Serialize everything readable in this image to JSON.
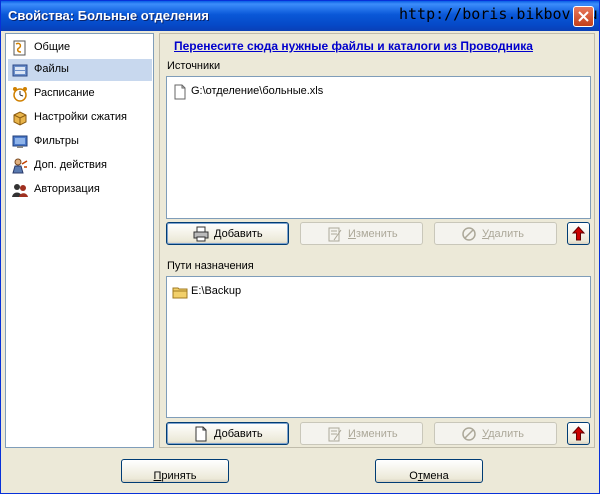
{
  "window": {
    "title": "Свойства: Больные отделения",
    "watermark": "http://boris.bikbov.ru"
  },
  "colors": {
    "title_bar": "#0a58d8",
    "link": "#0000cc",
    "selected_nav": "#c8d8ee",
    "up_arrow": "#cc0000"
  },
  "sidebar": {
    "items": [
      {
        "label": "Общие",
        "icon": "general-icon",
        "selected": false
      },
      {
        "label": "Файлы",
        "icon": "files-icon",
        "selected": true
      },
      {
        "label": "Расписание",
        "icon": "alarm-clock-icon",
        "selected": false
      },
      {
        "label": "Настройки сжатия",
        "icon": "compression-box-icon",
        "selected": false
      },
      {
        "label": "Фильтры",
        "icon": "monitor-icon",
        "selected": false
      },
      {
        "label": "Доп. действия",
        "icon": "person-action-icon",
        "selected": false
      },
      {
        "label": "Авторизация",
        "icon": "users-auth-icon",
        "selected": false
      }
    ]
  },
  "main": {
    "hint": "Перенесите сюда нужные файлы и каталоги из Проводника",
    "sources": {
      "label": "Источники",
      "items": [
        {
          "text": "G:\\отделение\\больные.xls",
          "icon": "file-icon"
        }
      ],
      "add": {
        "first": "Д",
        "rest": "обавить"
      },
      "edit": {
        "first": "И",
        "rest": "зменить"
      },
      "delete": {
        "first": "У",
        "rest": "далить"
      }
    },
    "destinations": {
      "label": "Пути назначения",
      "items": [
        {
          "text": "E:\\Backup",
          "icon": "folder-icon"
        }
      ],
      "add": {
        "first": "Д",
        "rest": "обавить"
      },
      "edit": {
        "first": "И",
        "rest": "зменить"
      },
      "delete": {
        "first": "У",
        "rest": "далить"
      }
    }
  },
  "footer": {
    "accept": {
      "first": "П",
      "rest": "ринять"
    },
    "cancel": {
      "pre": "О",
      "ul": "т",
      "rest": "мена"
    }
  }
}
